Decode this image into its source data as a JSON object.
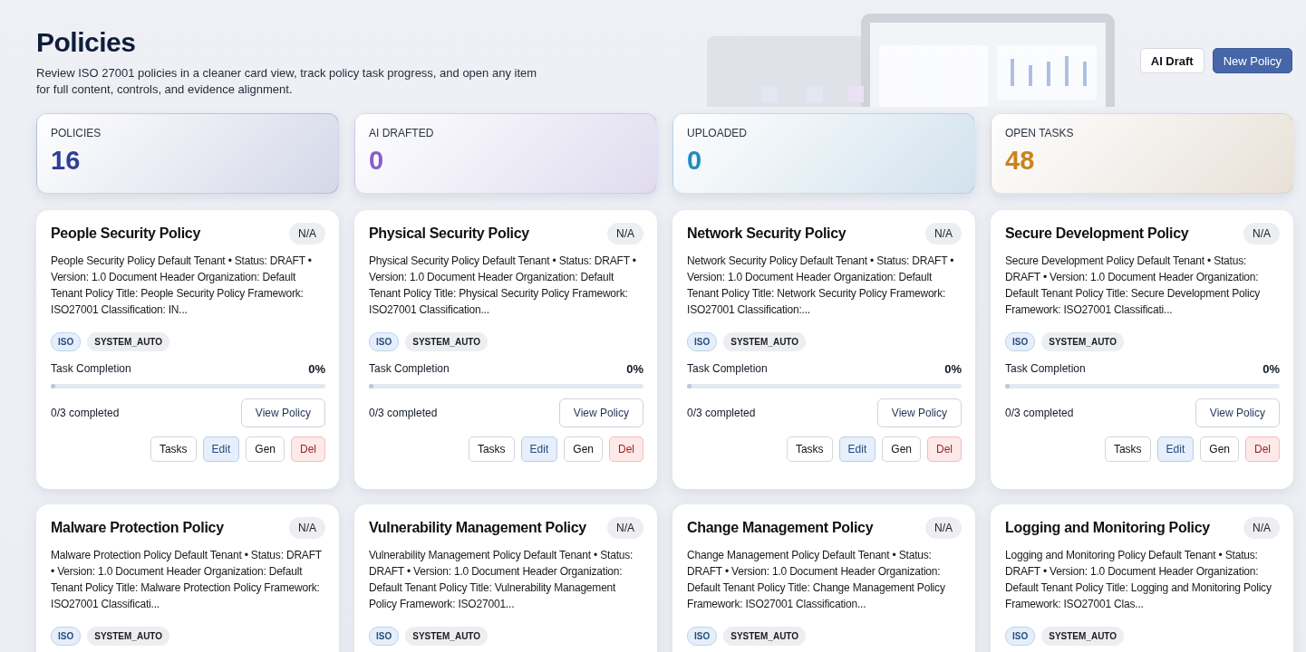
{
  "header": {
    "title": "Policies",
    "description": "Review ISO 27001 policies in a cleaner card view, track policy task progress, and open any item for full content, controls, and evidence alignment.",
    "actions": [
      {
        "label": "AI Draft",
        "kind": "secondary"
      },
      {
        "label": "New Policy",
        "kind": "primary"
      }
    ]
  },
  "stats": [
    {
      "label": "POLICIES",
      "value": "16",
      "color": "#2f3f96"
    },
    {
      "label": "AI DRAFTED",
      "value": "0",
      "color": "#8a5cc8"
    },
    {
      "label": "UPLOADED",
      "value": "0",
      "color": "#1f8cb8"
    },
    {
      "label": "OPEN TASKS",
      "value": "48",
      "color": "#c9841c"
    }
  ],
  "policies": [
    {
      "title": "People Security Policy",
      "badge": "N/A",
      "summary": "People Security Policy Default Tenant • Status: DRAFT • Version: 1.0 Document Header Organization: Default Tenant Policy Title: People Security Policy Framework: ISO27001 Classification: IN...",
      "tags": [
        {
          "label": "ISO",
          "kind": "framework"
        },
        {
          "label": "SYSTEM_AUTO",
          "kind": "source"
        }
      ],
      "progress": {
        "label": "Task Completion",
        "percent": "0%",
        "level": 0,
        "completed": "0/3 completed",
        "view": "View Policy"
      },
      "actions": [
        {
          "label": "Tasks",
          "kind": "neutral"
        },
        {
          "label": "Edit",
          "kind": "edit"
        },
        {
          "label": "Gen",
          "kind": "neutral"
        },
        {
          "label": "Del",
          "kind": "danger"
        }
      ]
    },
    {
      "title": "Physical Security Policy",
      "badge": "N/A",
      "summary": "Physical Security Policy Default Tenant • Status: DRAFT • Version: 1.0 Document Header Organization: Default Tenant Policy Title: Physical Security Policy Framework: ISO27001 Classification...",
      "tags": [
        {
          "label": "ISO",
          "kind": "framework"
        },
        {
          "label": "SYSTEM_AUTO",
          "kind": "source"
        }
      ],
      "progress": {
        "label": "Task Completion",
        "percent": "0%",
        "level": 0,
        "completed": "0/3 completed",
        "view": "View Policy"
      },
      "actions": [
        {
          "label": "Tasks",
          "kind": "neutral"
        },
        {
          "label": "Edit",
          "kind": "edit"
        },
        {
          "label": "Gen",
          "kind": "neutral"
        },
        {
          "label": "Del",
          "kind": "danger"
        }
      ]
    },
    {
      "title": "Network Security Policy",
      "badge": "N/A",
      "summary": "Network Security Policy Default Tenant • Status: DRAFT • Version: 1.0 Document Header Organization: Default Tenant Policy Title: Network Security Policy Framework: ISO27001 Classification:...",
      "tags": [
        {
          "label": "ISO",
          "kind": "framework"
        },
        {
          "label": "SYSTEM_AUTO",
          "kind": "source"
        }
      ],
      "progress": {
        "label": "Task Completion",
        "percent": "0%",
        "level": 0,
        "completed": "0/3 completed",
        "view": "View Policy"
      },
      "actions": [
        {
          "label": "Tasks",
          "kind": "neutral"
        },
        {
          "label": "Edit",
          "kind": "edit"
        },
        {
          "label": "Gen",
          "kind": "neutral"
        },
        {
          "label": "Del",
          "kind": "danger"
        }
      ]
    },
    {
      "title": "Secure Development Policy",
      "badge": "N/A",
      "summary": "Secure Development Policy Default Tenant • Status: DRAFT • Version: 1.0 Document Header Organization: Default Tenant Policy Title: Secure Development Policy Framework: ISO27001 Classificati...",
      "tags": [
        {
          "label": "ISO",
          "kind": "framework"
        },
        {
          "label": "SYSTEM_AUTO",
          "kind": "source"
        }
      ],
      "progress": {
        "label": "Task Completion",
        "percent": "0%",
        "level": 0,
        "completed": "0/3 completed",
        "view": "View Policy"
      },
      "actions": [
        {
          "label": "Tasks",
          "kind": "neutral"
        },
        {
          "label": "Edit",
          "kind": "edit"
        },
        {
          "label": "Gen",
          "kind": "neutral"
        },
        {
          "label": "Del",
          "kind": "danger"
        }
      ]
    },
    {
      "title": "Malware Protection Policy",
      "badge": "N/A",
      "summary": "Malware Protection Policy Default Tenant • Status: DRAFT • Version: 1.0 Document Header Organization: Default Tenant Policy Title: Malware Protection Policy Framework: ISO27001 Classificati...",
      "tags": [
        {
          "label": "ISO",
          "kind": "framework"
        },
        {
          "label": "SYSTEM_AUTO",
          "kind": "source"
        }
      ]
    },
    {
      "title": "Vulnerability Management Policy",
      "badge": "N/A",
      "summary": "Vulnerability Management Policy Default Tenant • Status: DRAFT • Version: 1.0 Document Header Organization: Default Tenant Policy Title: Vulnerability Management Policy Framework: ISO27001...",
      "tags": [
        {
          "label": "ISO",
          "kind": "framework"
        },
        {
          "label": "SYSTEM_AUTO",
          "kind": "source"
        }
      ]
    },
    {
      "title": "Change Management Policy",
      "badge": "N/A",
      "summary": "Change Management Policy Default Tenant • Status: DRAFT • Version: 1.0 Document Header Organization: Default Tenant Policy Title: Change Management Policy Framework: ISO27001 Classification...",
      "tags": [
        {
          "label": "ISO",
          "kind": "framework"
        },
        {
          "label": "SYSTEM_AUTO",
          "kind": "source"
        }
      ]
    },
    {
      "title": "Logging and Monitoring Policy",
      "badge": "N/A",
      "summary": "Logging and Monitoring Policy Default Tenant • Status: DRAFT • Version: 1.0 Document Header Organization: Default Tenant Policy Title: Logging and Monitoring Policy Framework: ISO27001 Clas...",
      "tags": [
        {
          "label": "ISO",
          "kind": "framework"
        },
        {
          "label": "SYSTEM_AUTO",
          "kind": "source"
        }
      ]
    }
  ]
}
